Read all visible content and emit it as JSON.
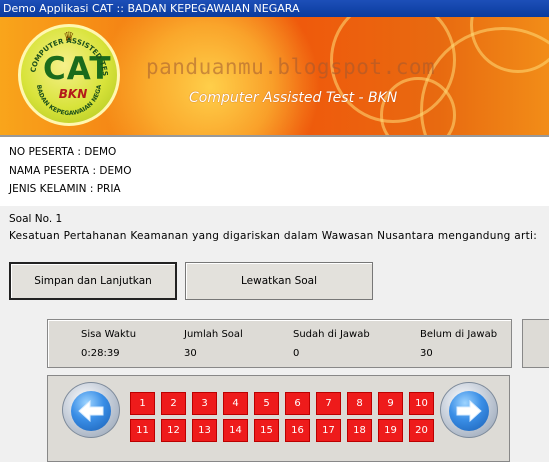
{
  "window": {
    "title": "Demo Applikasi CAT :: BADAN KEPEGAWAIAN NEGARA"
  },
  "banner": {
    "logo_text": "CAT",
    "logo_sub": "BKN",
    "logo_ring_top": "COMPUTER ASSISTED TEST",
    "logo_ring_bottom": "BADAN KEPEGAWAIAN NEGARA",
    "watermark": "panduanmu.blogspot.com",
    "subtitle": "Computer Assisted Test - BKN"
  },
  "participant": {
    "no_peserta": "NO PESERTA :  DEMO",
    "nama_peserta": "NAMA PESERTA : DEMO",
    "jenis_kelamin": "JENIS KELAMIN : PRIA"
  },
  "question": {
    "number": "Soal No. 1",
    "text": "Kesatuan Pertahanan Keamanan yang digariskan dalam Wawasan Nusantara mengandung arti:"
  },
  "buttons": {
    "save_next": "Simpan dan Lanjutkan",
    "skip": "Lewatkan Soal"
  },
  "status": {
    "time_label": "Sisa Waktu",
    "time_value": "0:28:39",
    "total_label": "Jumlah Soal",
    "total_value": "30",
    "answered_label": "Sudah di Jawab",
    "answered_value": "0",
    "unanswered_label": "Belum di Jawab",
    "unanswered_value": "30"
  },
  "navigator": {
    "row1": [
      "1",
      "2",
      "3",
      "4",
      "5",
      "6",
      "7",
      "8",
      "9",
      "10"
    ],
    "row2": [
      "11",
      "12",
      "13",
      "14",
      "15",
      "16",
      "17",
      "18",
      "19",
      "20"
    ],
    "prev_icon": "arrow-left-icon",
    "next_icon": "arrow-right-icon",
    "cell_color": "#ee1b1b"
  }
}
